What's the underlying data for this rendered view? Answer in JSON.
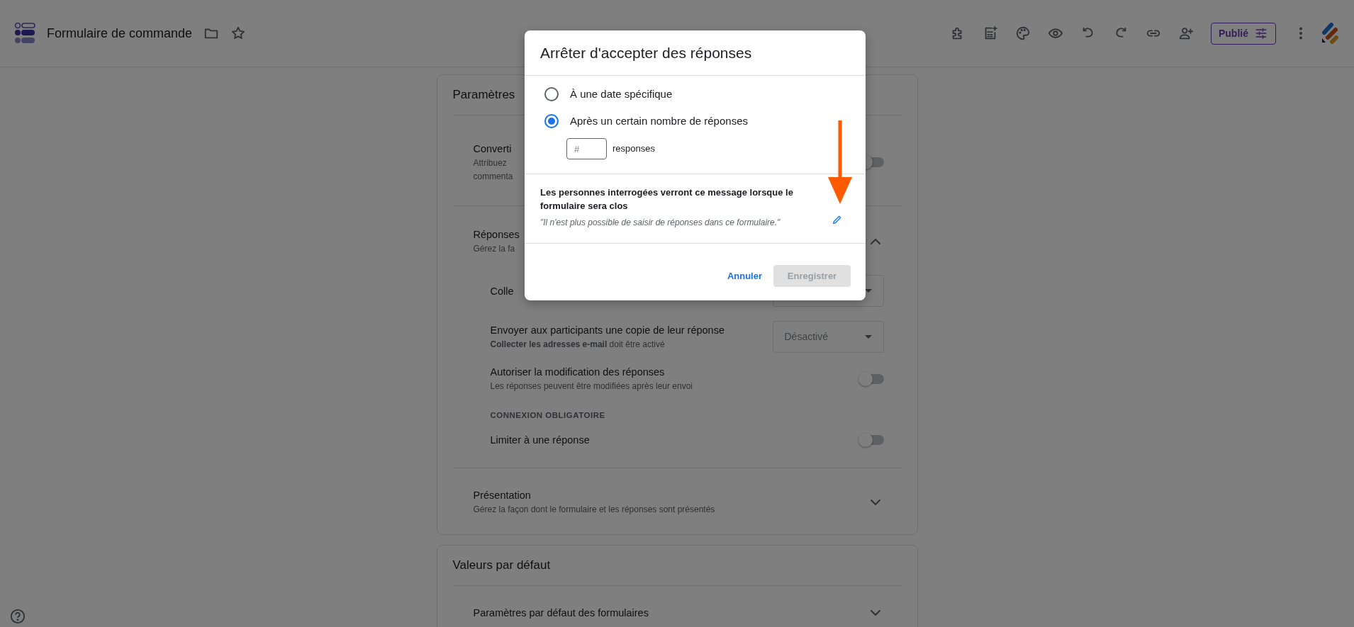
{
  "app_bar": {
    "title": "Formulaire de commande",
    "publish_button": "Publié"
  },
  "settings": {
    "title": "Paramètres",
    "items": [
      {
        "kind": "toggle",
        "title": "Converti",
        "description_lines": [
          "Attribuez",
          "commenta"
        ],
        "on": false
      },
      {
        "kind": "section",
        "title": "Réponses",
        "description": "Gérez la fa",
        "expanded": true,
        "children": [
          {
            "kind": "dropdown",
            "title": "Colle"
          },
          {
            "kind": "dropdown",
            "title": "Envoyer aux participants une copie de leur réponse",
            "description": "**Collecter les adresses e-mail** doit être activé",
            "value": "Désactivé"
          },
          {
            "kind": "toggle",
            "title": "Autoriser la modification des réponses",
            "description": "Les réponses peuvent être modifiées après leur envoi",
            "on": false
          },
          {
            "kind": "heading",
            "title": "CONNEXION OBLIGATOIRE"
          },
          {
            "kind": "toggle",
            "title": "Limiter à une réponse",
            "on": false
          }
        ]
      },
      {
        "kind": "section",
        "title": "Présentation",
        "description": "Gérez la façon dont le formulaire et les réponses sont présentés",
        "expanded": false
      }
    ]
  },
  "defaults": {
    "title": "Valeurs par défaut",
    "items": [
      {
        "kind": "section",
        "title": "Paramètres par défaut des formulaires",
        "expanded": false
      }
    ]
  },
  "dialog": {
    "title": "Arrêter d'accepter des réponses",
    "options": [
      {
        "label": "À une date spécifique",
        "selected": false
      },
      {
        "label": "Après un certain nombre de réponses",
        "selected": true
      }
    ],
    "count_field": {
      "placeholder": "#",
      "unit": "responses"
    },
    "message_heading": "Les personnes interrogées verront ce message lorsque le formulaire sera clos",
    "message": "\"Il n'est plus possible de saisir de réponses dans ce formulaire.\"",
    "cancel_button": "Annuler",
    "save_button": {
      "label": "Enregistrer",
      "disabled": true
    }
  }
}
